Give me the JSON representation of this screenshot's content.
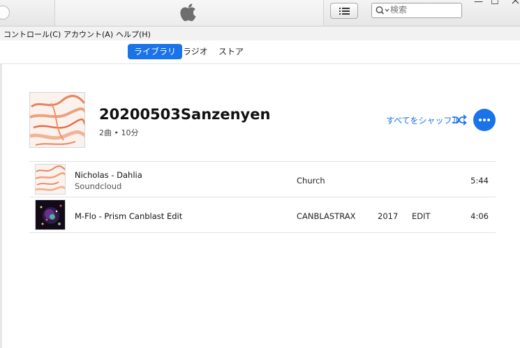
{
  "window": {
    "minimize_glyph": "—",
    "maximize_glyph": "☐"
  },
  "search": {
    "placeholder": "検索"
  },
  "menu": [
    "コントロール(C)",
    "アカウント(A)",
    "ヘルプ(H)"
  ],
  "nav_tabs": [
    {
      "label": "ライブラリ",
      "active": true
    },
    {
      "label": "ラジオ",
      "active": false
    },
    {
      "label": "ストア",
      "active": false
    }
  ],
  "playlist": {
    "title": "20200503Sanzenyen",
    "meta": "2曲 • 10分",
    "shuffle_label": "すべてをシャッフル"
  },
  "tracks": [
    {
      "name": "Nicholas - Dahlia",
      "sub": "Soundcloud",
      "artist": "Church",
      "year": "",
      "genre": "",
      "time": "5:44"
    },
    {
      "name": "M-Flo - Prism Canblast Edit",
      "sub": "",
      "artist": "CANBLASTRAX",
      "year": "2017",
      "genre": "EDIT",
      "time": "4:06"
    }
  ],
  "colors": {
    "accent": "#1a73e8"
  },
  "icons": [
    "apple-logo-icon",
    "list-view-icon",
    "search-icon",
    "shuffle-icon",
    "more-icon"
  ]
}
